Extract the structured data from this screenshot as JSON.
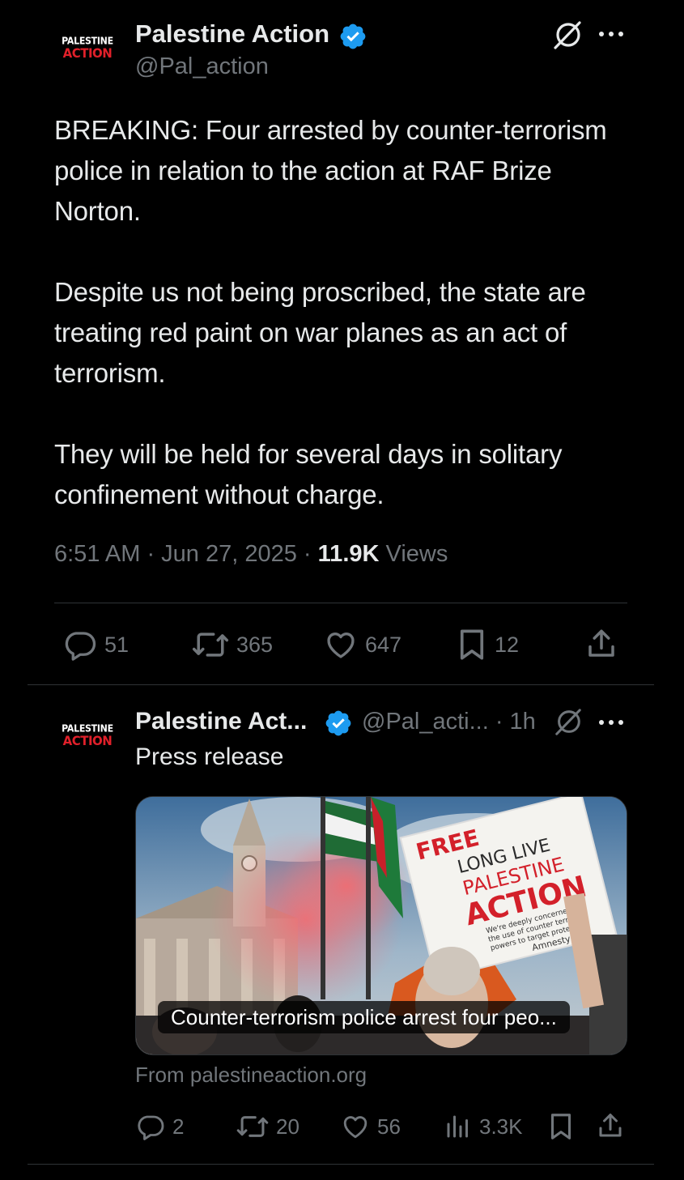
{
  "main_tweet": {
    "logo": {
      "line1": "PALESTINE",
      "line2": "ACTION"
    },
    "display_name": "Palestine Action",
    "handle": "@Pal_action",
    "paragraphs": [
      "BREAKING: Four arrested by counter-terrorism police in relation to the action at RAF Brize Norton.",
      "Despite us not being proscribed, the state are treating red paint on war planes as an act of terrorism.",
      "They will be held for several days in solitary confinement without charge."
    ],
    "time": "6:51 AM · Jun 27, 2025 ·",
    "views_count": "11.9K",
    "views_label": "Views",
    "replies": "51",
    "reposts": "365",
    "likes": "647",
    "bookmarks": "12"
  },
  "reply_tweet": {
    "logo": {
      "line1": "PALESTINE",
      "line2": "ACTION"
    },
    "display_name": "Palestine Act...",
    "handle_time": "@Pal_acti... · 1h",
    "text": "Press release",
    "card_caption": "Counter-terrorism police arrest four peo...",
    "card_placard_lines": [
      "FREE",
      "LONG LIVE",
      "PALESTINE",
      "ACTION",
      "We're deeply concerned at",
      "the use of counter terrorism",
      "powers to target protest",
      "Amnesty UK"
    ],
    "card_source": "From palestineaction.org",
    "replies": "2",
    "reposts": "20",
    "likes": "56",
    "views": "3.3K"
  },
  "colors": {
    "background": "#000000",
    "text": "#e7e9ea",
    "muted": "#71767b",
    "verified": "#1d9bf0",
    "divider": "#2f3336",
    "logo_red": "#e0202a"
  },
  "icons": [
    "verified-badge-icon",
    "grok-icon",
    "more-icon",
    "reply-icon",
    "repost-icon",
    "like-icon",
    "bookmark-icon",
    "share-icon",
    "views-icon"
  ]
}
